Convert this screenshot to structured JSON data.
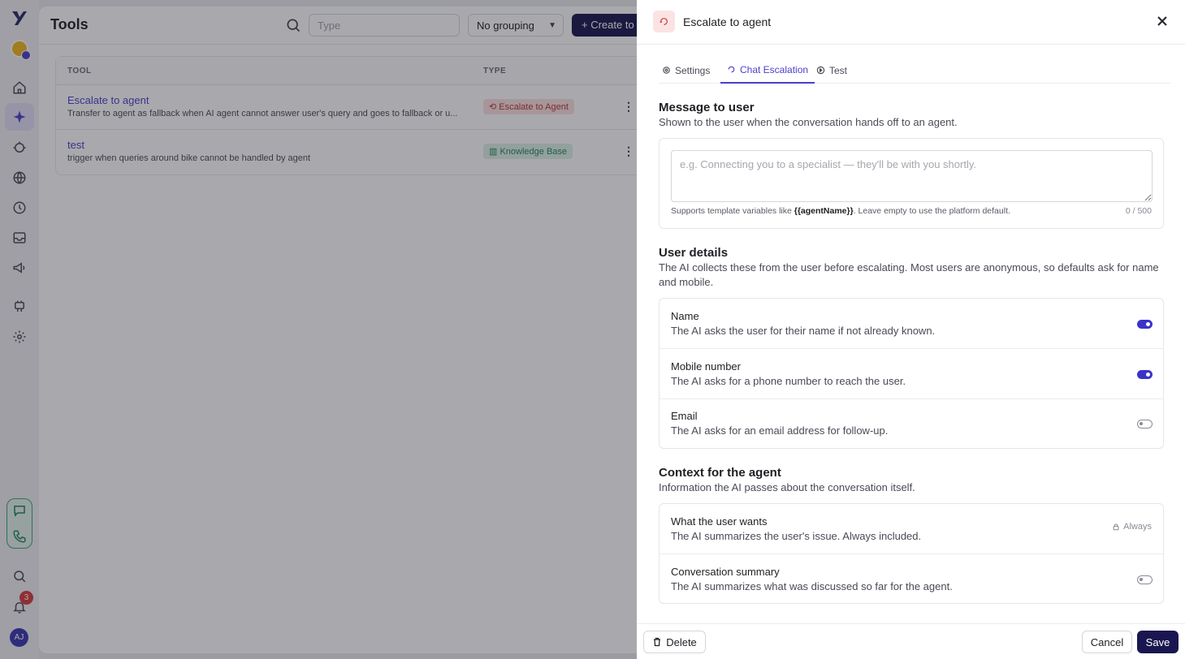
{
  "rail": {
    "icons": [
      "logo-icon",
      "org-icon",
      "home-icon",
      "ai-agent-icon",
      "bot-icon",
      "globe-icon",
      "history-icon",
      "inbox-icon",
      "campaign-icon",
      "plug-icon",
      "settings-icon",
      "chat-icon",
      "phone-icon",
      "search-icon",
      "bell-icon"
    ],
    "notifications": "3",
    "avatar_initials": "AJ"
  },
  "main": {
    "title": "Tools",
    "search": {
      "placeholder": "Type"
    },
    "grouping": "No grouping",
    "create_label": "+ Create to",
    "columns": [
      "TOOL",
      "TYPE"
    ],
    "rows": [
      {
        "name": "Escalate to agent",
        "desc": "Transfer to agent as fallback when AI agent cannot answer user's query and goes to fallback or u...",
        "type": "Escalate to Agent",
        "type_color": "#b53636"
      },
      {
        "name": "test",
        "desc": "trigger when queries around bike cannot be handled by agent",
        "type": "Knowledge Base",
        "type_color": "#23865a"
      }
    ]
  },
  "drawer": {
    "title": "Escalate to agent",
    "tabs": [
      "Settings",
      "Chat Escalation",
      "Test"
    ],
    "active_tab": "Chat Escalation",
    "message": {
      "title": "Message to user",
      "subtitle": "Shown to the user when the conversation hands off to an agent.",
      "placeholder": "e.g. Connecting you to a specialist — they'll be with you shortly.",
      "value": "",
      "hint_pre": "Supports template variables like ",
      "hint_var": "{{agentName}}",
      "hint_post": ". Leave empty to use the platform default.",
      "counter": "0 / 500"
    },
    "user_details": {
      "title": "User details",
      "subtitle": "The AI collects these from the user before escalating. Most users are anonymous, so defaults ask for name and mobile.",
      "items": [
        {
          "title": "Name",
          "desc": "The AI asks the user for their name if not already known.",
          "enabled": true
        },
        {
          "title": "Mobile number",
          "desc": "The AI asks for a phone number to reach the user.",
          "enabled": true
        },
        {
          "title": "Email",
          "desc": "The AI asks for an email address for follow-up.",
          "enabled": false
        }
      ]
    },
    "context": {
      "title": "Context for the agent",
      "subtitle": "Information the AI passes about the conversation itself.",
      "items": [
        {
          "title": "What the user wants",
          "desc": "The AI summarizes the user's issue. Always included.",
          "always_label": "Always"
        },
        {
          "title": "Conversation summary",
          "desc": "The AI summarizes what was discussed so far for the agent.",
          "enabled": false
        }
      ]
    },
    "footer": {
      "delete": "Delete",
      "cancel": "Cancel",
      "save": "Save"
    }
  }
}
